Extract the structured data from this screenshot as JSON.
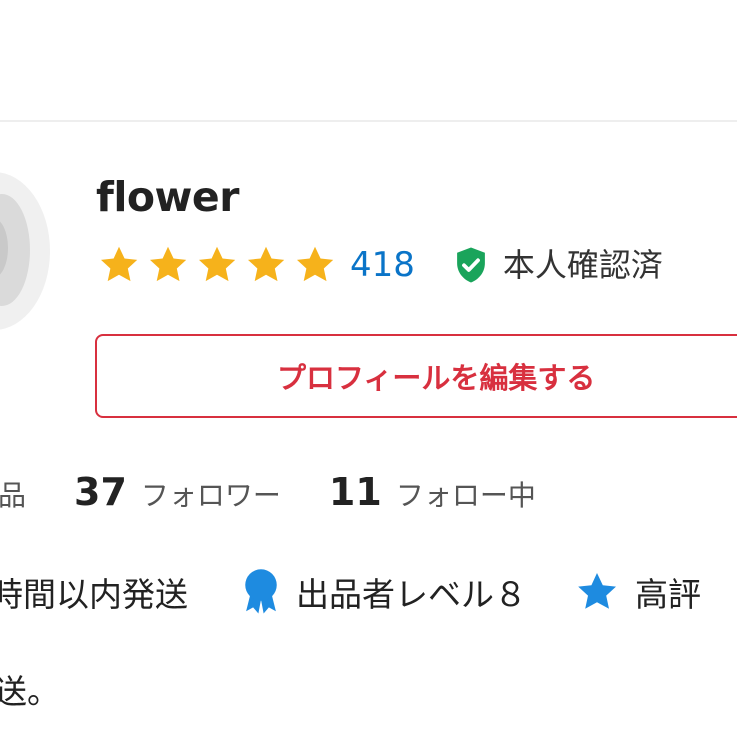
{
  "profile": {
    "username": "flower",
    "rating_stars": 5,
    "rating_count": "418",
    "verified_label": "本人確認済",
    "edit_button_label": "プロフィールを編集する"
  },
  "stats": {
    "items_label_partial": "出品",
    "followers_count": "37",
    "followers_label": "フォロワー",
    "following_count": "11",
    "following_label": "フォロー中"
  },
  "badges": {
    "shipping_label_partial": "時間以内発送",
    "seller_level_label": "出品者レベル８",
    "high_rating_label_partial": "高評"
  },
  "description": {
    "line_partial": "送。"
  },
  "colors": {
    "star": "#f6b21b",
    "rating_count": "#0a74c8",
    "verified_shield": "#1aa45b",
    "edit_button": "#d8303f",
    "medal": "#1e8be0",
    "blue_star": "#1e8be0"
  },
  "icons": {
    "rating": "star-icon",
    "verified": "shield-check-icon",
    "seller_level": "medal-icon",
    "high_rating": "star-icon"
  }
}
